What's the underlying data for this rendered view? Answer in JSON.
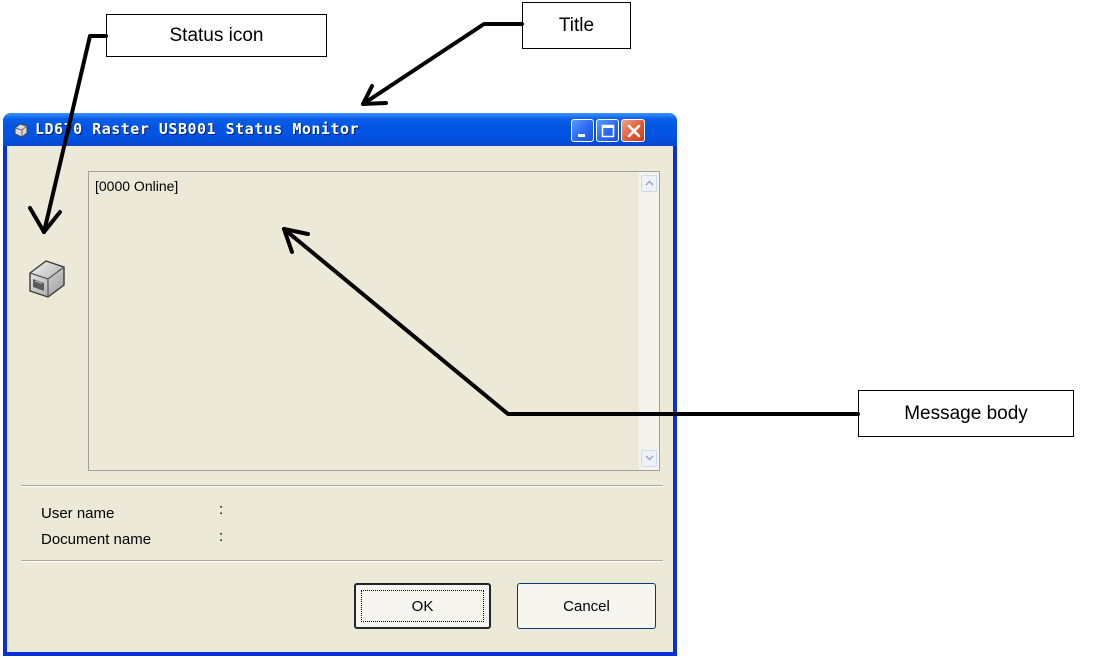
{
  "callouts": {
    "status_icon": "Status icon",
    "title": "Title",
    "message_body": "Message body"
  },
  "window": {
    "title": "LD670 Raster USB001 Status Monitor",
    "message": "[0000 Online]",
    "user_name_label": "User name",
    "document_name_label": "Document name",
    "colon": ":",
    "ok_label": "OK",
    "cancel_label": "Cancel"
  },
  "icons": [
    "printer-icon",
    "minimize-icon",
    "maximize-icon",
    "close-icon",
    "scroll-up-icon",
    "scroll-down-icon"
  ],
  "colors": {
    "titlebar": "#0054e3",
    "window_face": "#ece9d8",
    "close_button": "#e25a33"
  }
}
